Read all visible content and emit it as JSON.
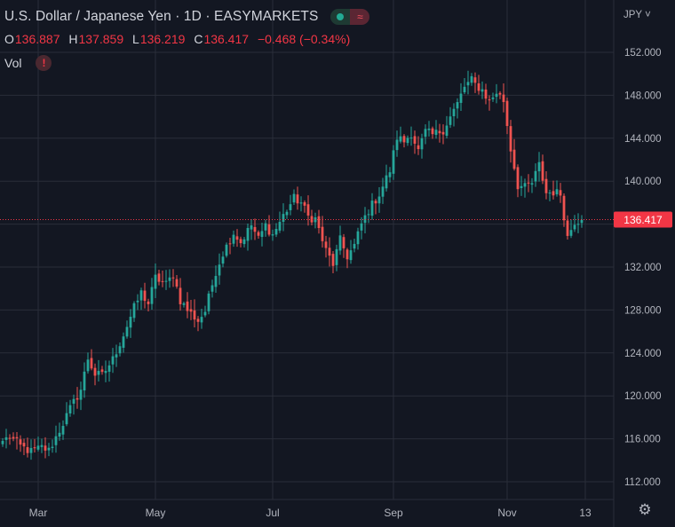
{
  "legend": {
    "title": "U.S. Dollar / Japanese Yen · 1D · EASYMARKETS",
    "ohlc": {
      "o_label": "O",
      "o": "136.887",
      "h_label": "H",
      "h": "137.859",
      "l_label": "L",
      "l": "136.219",
      "c_label": "C",
      "c": "136.417",
      "change": "−0.468 (−0.34%)"
    },
    "vol_label": "Vol",
    "vol_warning_icon": "!",
    "market_wave_icon": "≈"
  },
  "currency_selector": "JPY ˅",
  "settings_icon": "⚙",
  "colors": {
    "background": "#131722",
    "grid": "#2a2e39",
    "up": "#26a69a",
    "down": "#ef5350",
    "last_price": "#f23645",
    "axis_text": "#b2b5be"
  },
  "chart_data": {
    "type": "candlestick",
    "title": "U.S. Dollar / Japanese Yen · 1D · EASYMARKETS",
    "ylim": [
      110.5,
      155.5
    ],
    "y_ticks": [
      {
        "v": 152,
        "label": "152.000"
      },
      {
        "v": 148,
        "label": "148.000"
      },
      {
        "v": 144,
        "label": "144.000"
      },
      {
        "v": 140,
        "label": "140.000"
      },
      {
        "v": 136,
        "label": "136.000"
      },
      {
        "v": 132,
        "label": "132.000"
      },
      {
        "v": 128,
        "label": "128.000"
      },
      {
        "v": 124,
        "label": "124.000"
      },
      {
        "v": 120,
        "label": "120.000"
      },
      {
        "v": 116,
        "label": "116.000"
      },
      {
        "v": 112,
        "label": "112.000"
      }
    ],
    "x_ticks": [
      {
        "i": 10,
        "label": "Mar"
      },
      {
        "i": 43,
        "label": "May"
      },
      {
        "i": 76,
        "label": "Jul"
      },
      {
        "i": 110,
        "label": "Sep"
      },
      {
        "i": 142,
        "label": "Nov"
      },
      {
        "i": 164,
        "label": "13"
      }
    ],
    "last_price": {
      "value": 136.417,
      "label": "136.417"
    },
    "grid": true,
    "anchors": [
      [
        0,
        115.8
      ],
      [
        2,
        116.2
      ],
      [
        5,
        115.3
      ],
      [
        8,
        114.8
      ],
      [
        11,
        115.2
      ],
      [
        13,
        114.9
      ],
      [
        16,
        116.8
      ],
      [
        19,
        118.8
      ],
      [
        22,
        120.6
      ],
      [
        24,
        123.5
      ],
      [
        26,
        122.0
      ],
      [
        28,
        121.9
      ],
      [
        31,
        123.4
      ],
      [
        34,
        125.7
      ],
      [
        37,
        128.2
      ],
      [
        39,
        129.6
      ],
      [
        41,
        128.6
      ],
      [
        43,
        131.0
      ],
      [
        46,
        130.4
      ],
      [
        48,
        131.3
      ],
      [
        50,
        128.9
      ],
      [
        52,
        128.0
      ],
      [
        55,
        127.0
      ],
      [
        57,
        127.9
      ],
      [
        60,
        131.6
      ],
      [
        62,
        133.3
      ],
      [
        65,
        135.2
      ],
      [
        67,
        134.3
      ],
      [
        70,
        135.9
      ],
      [
        72,
        134.6
      ],
      [
        74,
        135.9
      ],
      [
        76,
        135.0
      ],
      [
        79,
        136.8
      ],
      [
        82,
        138.4
      ],
      [
        84,
        138.0
      ],
      [
        86,
        136.7
      ],
      [
        88,
        136.5
      ],
      [
        91,
        133.5
      ],
      [
        93,
        132.3
      ],
      [
        95,
        134.5
      ],
      [
        97,
        133.0
      ],
      [
        99,
        134.0
      ],
      [
        101,
        136.0
      ],
      [
        103,
        137.3
      ],
      [
        106,
        138.8
      ],
      [
        109,
        141.0
      ],
      [
        111,
        144.1
      ],
      [
        113,
        143.7
      ],
      [
        115,
        144.5
      ],
      [
        117,
        142.8
      ],
      [
        119,
        144.6
      ],
      [
        121,
        144.3
      ],
      [
        124,
        144.8
      ],
      [
        126,
        146.0
      ],
      [
        128,
        147.2
      ],
      [
        130,
        148.8
      ],
      [
        132,
        149.4
      ],
      [
        133,
        149.0
      ],
      [
        135,
        148.5
      ],
      [
        137,
        147.4
      ],
      [
        139,
        148.3
      ],
      [
        141,
        147.5
      ],
      [
        143,
        143.0
      ],
      [
        145,
        139.6
      ],
      [
        147,
        139.4
      ],
      [
        149,
        139.8
      ],
      [
        151,
        141.5
      ],
      [
        153,
        138.9
      ],
      [
        155,
        139.0
      ],
      [
        157,
        138.8
      ],
      [
        159,
        134.8
      ],
      [
        161,
        136.3
      ],
      [
        163,
        136.4
      ]
    ]
  }
}
